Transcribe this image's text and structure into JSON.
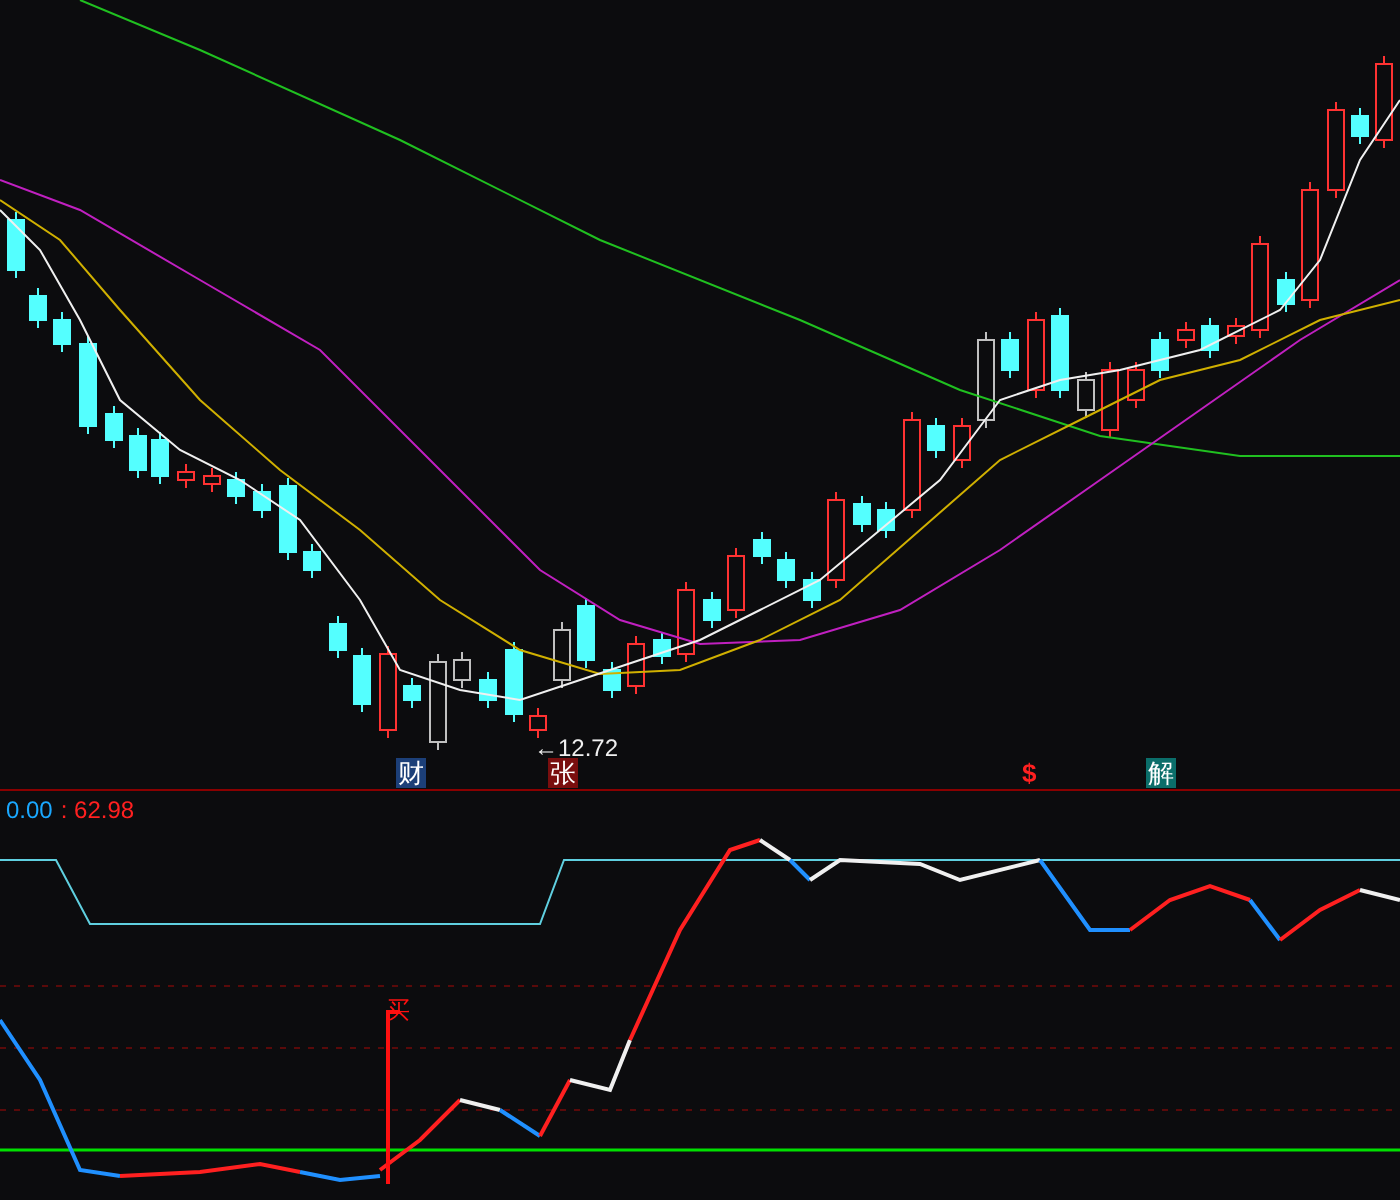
{
  "price_chart": {
    "low_annotation": "←12.72",
    "event_badges": [
      {
        "label": "财",
        "kind": "boxed",
        "color": "#1c3f78"
      },
      {
        "label": "张",
        "kind": "boxed",
        "color": "#7a0e0e"
      },
      {
        "label": "$",
        "kind": "plain",
        "color": "#ff2020"
      },
      {
        "label": "解",
        "kind": "boxed",
        "color": "#0b6e6a"
      }
    ]
  },
  "indicator": {
    "readout": {
      "value_1": "0.00",
      "value_2": ": 62.98"
    },
    "signals": [
      {
        "label": "买"
      }
    ]
  }
}
